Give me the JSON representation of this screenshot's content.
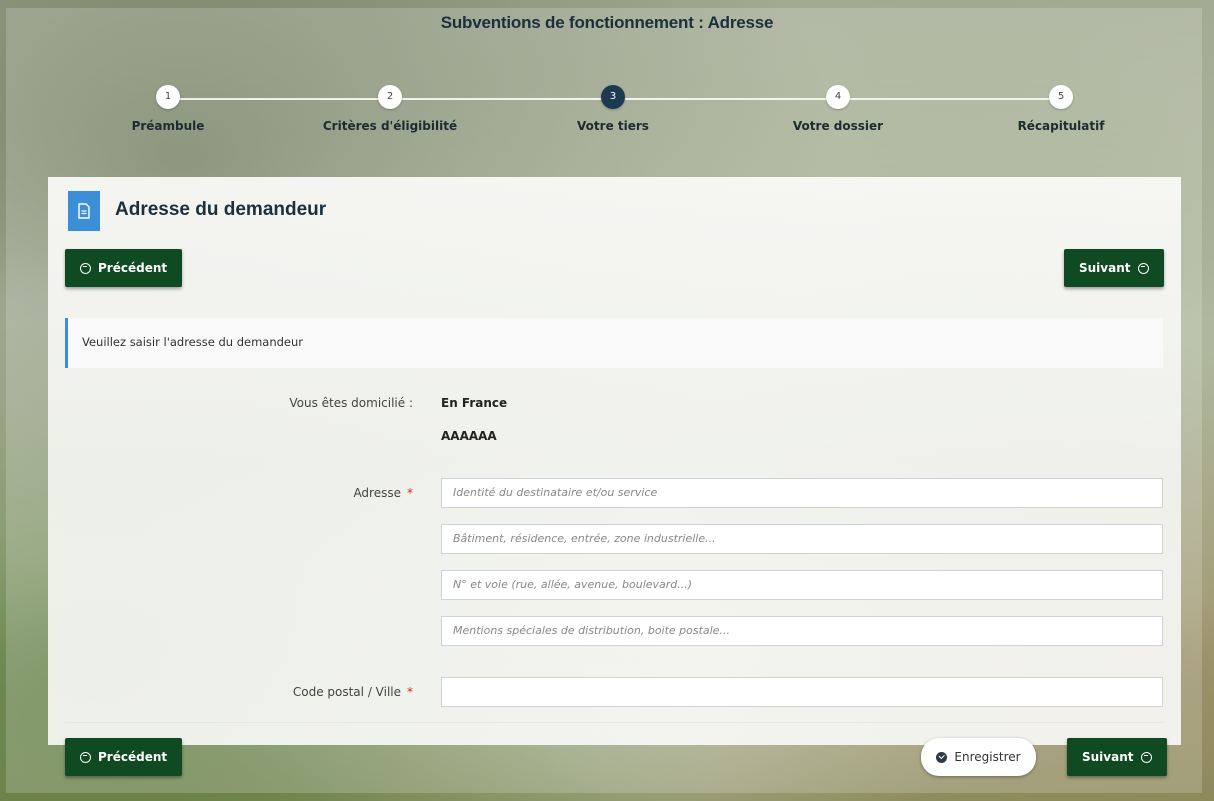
{
  "page": {
    "title": "Subventions de fonctionnement : Adresse"
  },
  "stepper": {
    "steps": [
      {
        "number": "1",
        "label": "Préambule"
      },
      {
        "number": "2",
        "label": "Critères d'éligibilité"
      },
      {
        "number": "3",
        "label": "Votre tiers"
      },
      {
        "number": "4",
        "label": "Votre dossier"
      },
      {
        "number": "5",
        "label": "Récapitulatif"
      }
    ],
    "active_step": 3
  },
  "section": {
    "title": "Adresse du demandeur",
    "icon": "document-icon"
  },
  "nav": {
    "previous_label": "Précédent",
    "next_label": "Suivant",
    "save_label": "Enregistrer"
  },
  "info": {
    "message": "Veuillez saisir l'adresse du demandeur"
  },
  "form": {
    "domicile_label": "Vous êtes domicilié :",
    "domicile_value": "En France",
    "domicile_extra": "AAAAAA",
    "address_label": "Adresse",
    "address_required_mark": "*",
    "address_lines": [
      {
        "placeholder": "Identité du destinataire et/ou service",
        "value": ""
      },
      {
        "placeholder": "Bâtiment, résidence, entrée, zone industrielle...",
        "value": ""
      },
      {
        "placeholder": "N° et voie (rue, allée, avenue, boulevard...)",
        "value": ""
      },
      {
        "placeholder": "Mentions spéciales de distribution, boite postale...",
        "value": ""
      }
    ],
    "postal_label": "Code postal / Ville",
    "postal_required_mark": "*",
    "postal_value": ""
  },
  "colors": {
    "primary_button": "#0f4a23",
    "accent": "#3c8fd6",
    "active_step": "#1c3b52",
    "required": "#dd2222"
  }
}
